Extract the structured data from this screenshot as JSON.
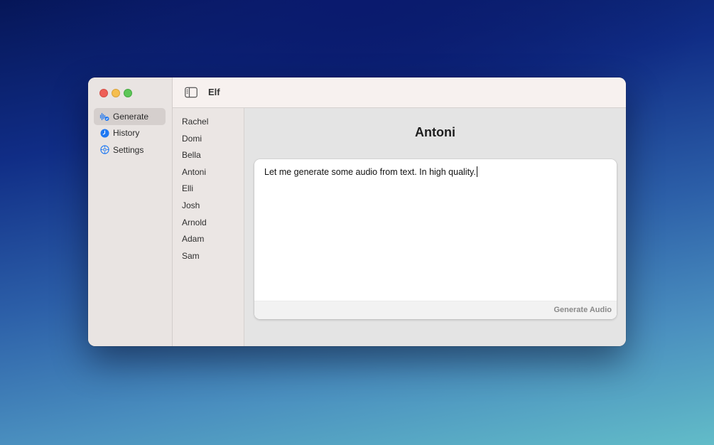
{
  "app": {
    "title": "Elf"
  },
  "sidebar": {
    "items": [
      {
        "label": "Generate",
        "icon": "waveform-icon",
        "active": true
      },
      {
        "label": "History",
        "icon": "clock-icon",
        "active": false
      },
      {
        "label": "Settings",
        "icon": "gear-icon",
        "active": false
      }
    ]
  },
  "voices": {
    "items": [
      "Rachel",
      "Domi",
      "Bella",
      "Antoni",
      "Elli",
      "Josh",
      "Arnold",
      "Adam",
      "Sam"
    ],
    "selected": "Antoni"
  },
  "detail": {
    "title": "Antoni",
    "text": "Let me generate some audio from text. In high quality.",
    "generate_label": "Generate Audio"
  },
  "colors": {
    "accent": "#1f78f2",
    "traffic_close": "#ee5f57",
    "traffic_minimize": "#f5be4f",
    "traffic_maximize": "#5dc657"
  }
}
